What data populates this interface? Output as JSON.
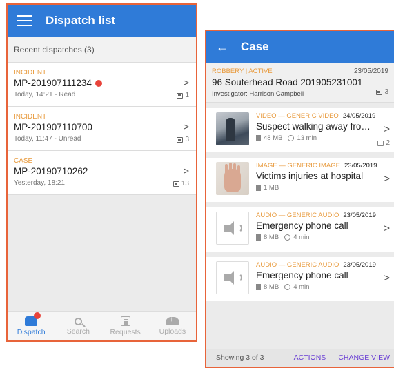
{
  "dispatch_screen": {
    "title": "Dispatch list",
    "section_header": "Recent dispatches (3)",
    "items": [
      {
        "type": "INCIDENT",
        "id": "MP-201907111234",
        "unread_dot": true,
        "meta": "Today, 14:21 - Read",
        "count": "1"
      },
      {
        "type": "INCIDENT",
        "id": "MP-201907110700",
        "unread_dot": false,
        "meta": "Today, 11:47 - Unread",
        "count": "3"
      },
      {
        "type": "CASE",
        "id": "MP-20190710262",
        "unread_dot": false,
        "meta": "Yesterday, 18:21",
        "count": "13"
      }
    ],
    "nav": [
      {
        "label": "Dispatch",
        "icon": "car-icon",
        "active": true
      },
      {
        "label": "Search",
        "icon": "search-icon",
        "active": false
      },
      {
        "label": "Requests",
        "icon": "list-icon",
        "active": false
      },
      {
        "label": "Uploads",
        "icon": "upload-cloud-icon",
        "active": false
      }
    ]
  },
  "case_screen": {
    "title": "Case",
    "header": {
      "type_status": "ROBBERY | ACTIVE",
      "date": "23/05/2019",
      "title": "96 Souterhead Road 201905231001",
      "investigator": "Investigator: Harrison Campbell",
      "count": "3"
    },
    "items": [
      {
        "category": "VIDEO — GENERIC VIDEO",
        "date": "24/05/2019",
        "title": "Suspect walking away from vi...",
        "size": "48 MB",
        "duration": "13 min",
        "count": "2",
        "thumb": "video"
      },
      {
        "category": "IMAGE — GENERIC IMAGE",
        "date": "23/05/2019",
        "title": "Victims injuries at hospital",
        "size": "1 MB",
        "duration": "",
        "count": "",
        "thumb": "image"
      },
      {
        "category": "AUDIO — GENERIC AUDIO",
        "date": "23/05/2019",
        "title": "Emergency phone call",
        "size": "8 MB",
        "duration": "4 min",
        "count": "",
        "thumb": "audio"
      },
      {
        "category": "AUDIO — GENERIC AUDIO",
        "date": "23/05/2019",
        "title": "Emergency phone call",
        "size": "8 MB",
        "duration": "4 min",
        "count": "",
        "thumb": "audio"
      }
    ],
    "footer": {
      "showing": "Showing 3 of 3",
      "actions": "ACTIONS",
      "change_view": "CHANGE VIEW"
    }
  },
  "colors": {
    "appbar": "#2f7bd8",
    "frame_border": "#e8643a",
    "category_text": "#e89a3c",
    "action_text": "#6a3fd4",
    "unread_dot": "#e8433a"
  }
}
